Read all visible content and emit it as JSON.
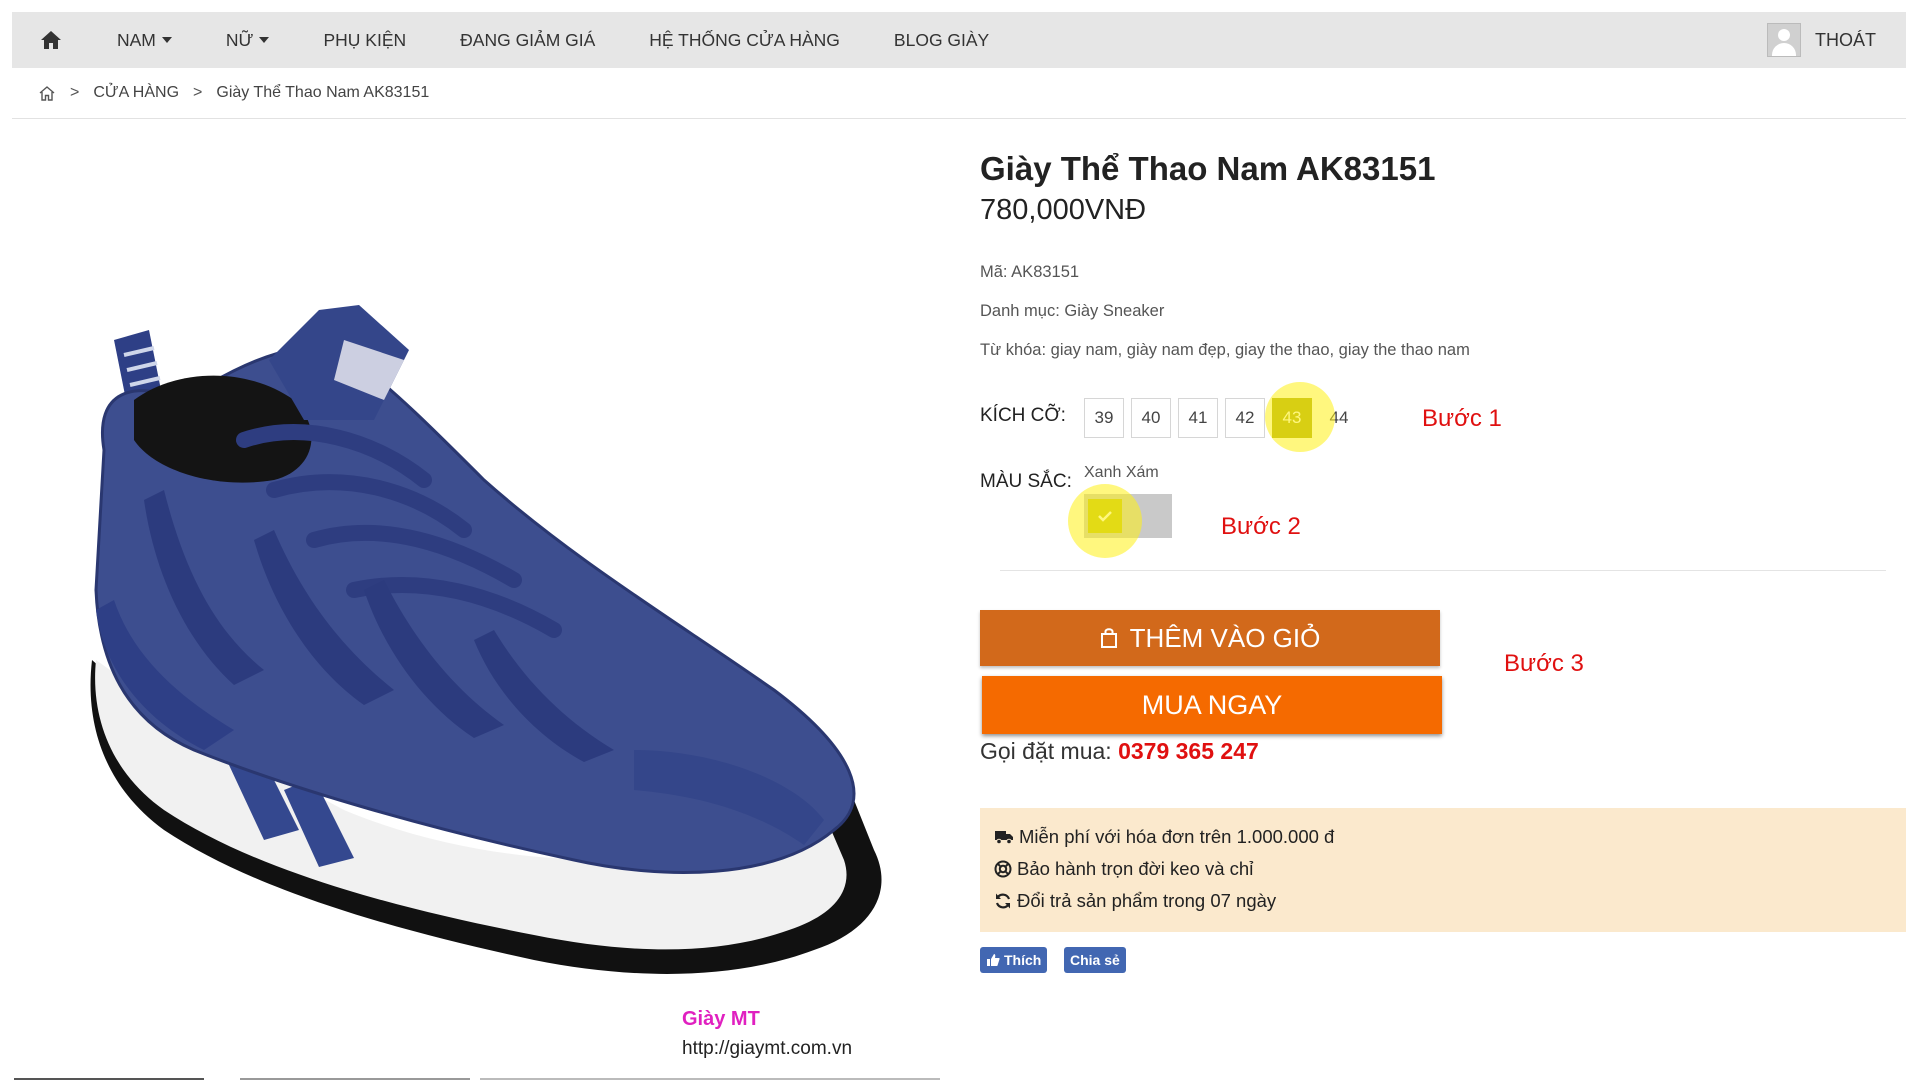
{
  "nav": {
    "items": [
      {
        "label": "NAM",
        "dropdown": true
      },
      {
        "label": "NỮ",
        "dropdown": true
      },
      {
        "label": "PHỤ KIỆN",
        "dropdown": false
      },
      {
        "label": "ĐANG GIẢM GIÁ",
        "dropdown": false
      },
      {
        "label": "HỆ THỐNG CỬA HÀNG",
        "dropdown": false
      },
      {
        "label": "BLOG GIÀY",
        "dropdown": false
      }
    ],
    "logout_label": "THOÁT"
  },
  "breadcrumb": {
    "shop": "CỬA HÀNG",
    "current": "Giày Thể Thao Nam AK83151",
    "separator": ">"
  },
  "product": {
    "title": "Giày Thể Thao Nam AK83151",
    "price": "780,000VNĐ",
    "code": "Mã: AK83151",
    "category": "Danh mục: Giày Sneaker",
    "keywords": "Từ khóa: giay nam, giày nam đẹp, giay the thao, giay the thao nam",
    "size_label": "KÍCH CỠ:",
    "sizes": [
      "39",
      "40",
      "41",
      "42",
      "43",
      "44"
    ],
    "selected_size": "43",
    "color_label": "MÀU SẮC:",
    "color_name": "Xanh Xám",
    "color_swatch": "#c9c9c9",
    "add_to_cart": "THÊM VÀO GIỎ",
    "buy_now": "MUA NGAY",
    "call_prefix": "Gọi đặt mua:",
    "phone": "0379 365 247"
  },
  "perks": [
    {
      "icon": "truck-icon",
      "text": "Miễn phí với hóa đơn trên 1.000.000 đ"
    },
    {
      "icon": "lifebuoy-icon",
      "text": "Bảo hành trọn đời keo và chỉ"
    },
    {
      "icon": "refresh-icon",
      "text": "Đổi trả sản phẩm trong 07 ngày"
    }
  ],
  "social": {
    "like": "Thích",
    "share": "Chia sẻ"
  },
  "steps": {
    "step1": "Bước 1",
    "step2": "Bước 2",
    "step3": "Bước 3"
  },
  "watermark": {
    "brand": "Giày MT",
    "url": "http://giaymt.com.vn"
  },
  "colors": {
    "nav_bg": "#e6e6e6",
    "cart_button": "#d2691b",
    "buy_button": "#f56a00",
    "selected_size": "#a8a613",
    "step_text": "#e01010",
    "perks_bg": "#fbe9cd",
    "facebook": "#4267b2"
  }
}
